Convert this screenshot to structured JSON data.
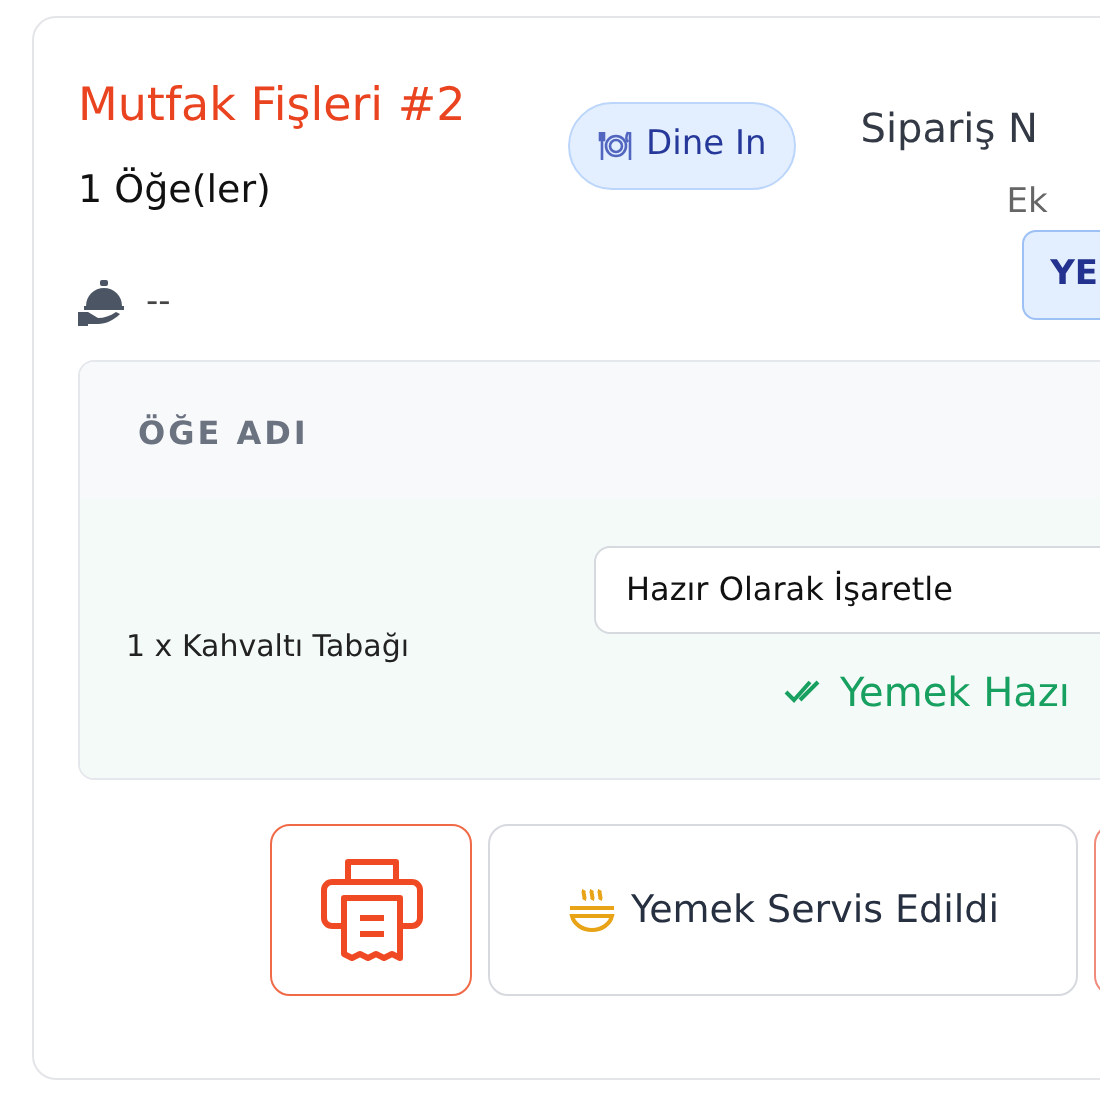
{
  "ticket": {
    "title": "Mutfak Fişleri #2",
    "item_count": "1 Öğe(ler)",
    "order_type": "Dine In",
    "order_label": "Sipariş N",
    "order_sub": "Ek",
    "waiter": "--",
    "status_button": "YE"
  },
  "items_table": {
    "column_header": "ÖĞE ADI",
    "rows": [
      {
        "name": "1 x Kahvaltı Tabağı",
        "action": "Hazır Olarak İşaretle",
        "status": "Yemek Hazı"
      }
    ]
  },
  "buttons": [
    {
      "kind": "print"
    },
    {
      "kind": "served",
      "label": "Yemek Servis Edildi"
    },
    {
      "kind": "cut"
    }
  ]
}
